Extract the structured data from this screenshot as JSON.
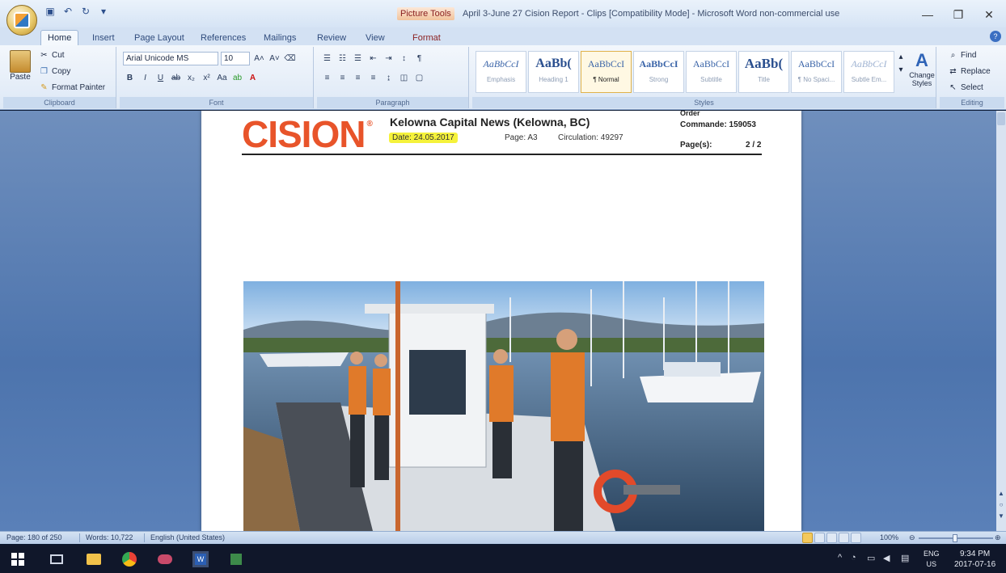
{
  "window": {
    "context_tab": "Picture Tools",
    "title": "April 3-June 27 Cision Report - Clips [Compatibility Mode] - Microsoft Word non-commercial use"
  },
  "ribbon_tabs": [
    "Home",
    "Insert",
    "Page Layout",
    "References",
    "Mailings",
    "Review",
    "View",
    "Format"
  ],
  "clipboard": {
    "paste": "Paste",
    "cut": "Cut",
    "copy": "Copy",
    "format_painter": "Format Painter",
    "label": "Clipboard"
  },
  "font": {
    "name": "Arial Unicode MS",
    "size": "10",
    "label": "Font"
  },
  "paragraph": {
    "label": "Paragraph"
  },
  "styles": {
    "label": "Styles",
    "change_styles": "Change Styles",
    "items": [
      {
        "sample": "AaBbCcI",
        "name": "Emphasis"
      },
      {
        "sample": "AaBb(",
        "name": "Heading 1"
      },
      {
        "sample": "AaBbCcI",
        "name": "¶ Normal"
      },
      {
        "sample": "AaBbCcI",
        "name": "Strong"
      },
      {
        "sample": "AaBbCcI",
        "name": "Subtitle"
      },
      {
        "sample": "AaBb(",
        "name": "Title"
      },
      {
        "sample": "AaBbCcI",
        "name": "¶ No Spaci..."
      },
      {
        "sample": "AaBbCcI",
        "name": "Subtle Em..."
      }
    ]
  },
  "editing": {
    "find": "Find",
    "replace": "Replace",
    "select": "Select",
    "label": "Editing"
  },
  "document": {
    "logo": "CISION",
    "publication": "Kelowna Capital News (Kelowna, BC)",
    "date": "Date: 24.05.2017",
    "page": "Page: A3",
    "circulation": "Circulation: 49297",
    "order_label": "Order",
    "commande": "Commande: 159053",
    "pages_label": "Page(s):",
    "pages_value": "2 / 2"
  },
  "status": {
    "page": "Page: 180 of 250",
    "words": "Words: 10,722",
    "language": "English (United States)",
    "zoom": "100%"
  },
  "taskbar": {
    "lang_top": "ENG",
    "lang_bottom": "US",
    "time": "9:34 PM",
    "date": "2017-07-16"
  },
  "colors": {
    "cision_orange": "#e8542a",
    "highlight_yellow": "#f5f23b",
    "taskbar": "#10172a"
  }
}
